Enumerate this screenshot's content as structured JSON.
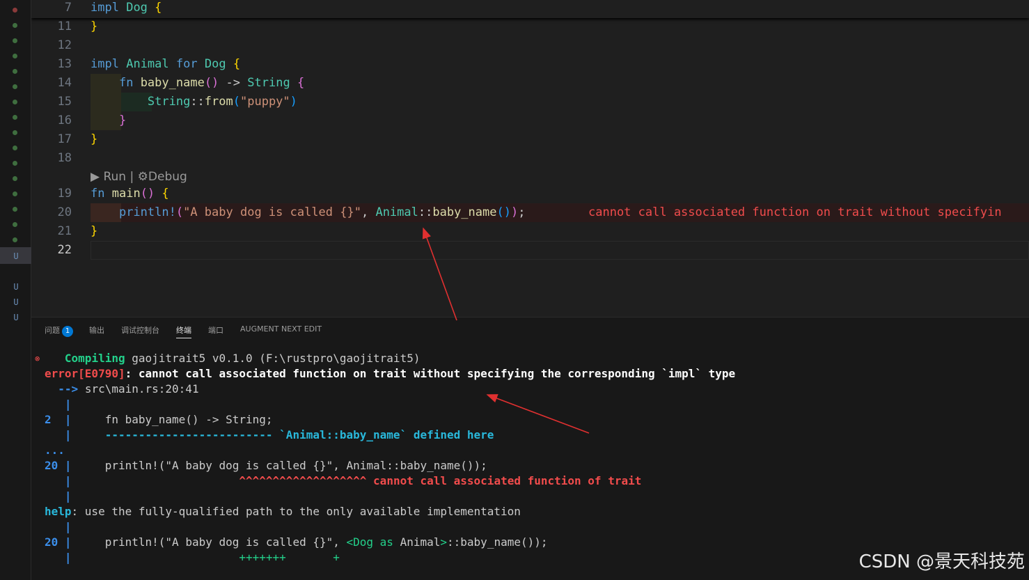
{
  "editor": {
    "sticky": {
      "line_no": "7",
      "code": "impl Dog {"
    },
    "lines": [
      {
        "n": "11"
      },
      {
        "n": "12"
      },
      {
        "n": "13"
      },
      {
        "n": "14"
      },
      {
        "n": "15"
      },
      {
        "n": "16"
      },
      {
        "n": "17"
      },
      {
        "n": "18"
      },
      {
        "n": "19"
      },
      {
        "n": "20"
      },
      {
        "n": "21"
      },
      {
        "n": "22"
      }
    ],
    "code": {
      "l11": "}",
      "l13": [
        "impl",
        "Animal",
        "for",
        "Dog",
        "{"
      ],
      "l14": [
        "fn",
        "baby_name",
        "()",
        "->",
        "String",
        "{"
      ],
      "l15": [
        "String",
        "::",
        "from",
        "(",
        "\"puppy\"",
        ")"
      ],
      "l16": "}",
      "l17": "}",
      "l19": [
        "fn",
        "main",
        "()",
        "{"
      ],
      "l20": [
        "println!",
        "(",
        "\"A baby dog is called {}\"",
        ", ",
        "Animal",
        "::",
        "baby_name",
        "()",
        ")",
        ";"
      ],
      "l21": "}"
    },
    "codelens": {
      "run": "Run",
      "separator": "|",
      "debug": "Debug"
    },
    "inline_error": "cannot call associated function on trait without specifyin"
  },
  "panel": {
    "tabs": [
      {
        "label": "问题",
        "badge": "1"
      },
      {
        "label": "输出"
      },
      {
        "label": "调试控制台"
      },
      {
        "label": "终端",
        "active": true
      },
      {
        "label": "端口"
      },
      {
        "label": "AUGMENT NEXT EDIT"
      }
    ],
    "terminal": {
      "compiling_label": "Compiling",
      "compiling_rest": "gaojitrait5 v0.1.0 (F:\\rustpro\\gaojitrait5)",
      "error_code": "error[E0790]",
      "error_msg": ": cannot call associated function on trait without specifying the corresponding `impl` type",
      "arrow": "-->",
      "location": "src\\main.rs:20:41",
      "pipe": "|",
      "ln2": "2",
      "ln2_code": "fn baby_name() -> String;",
      "dashes": "------------------------- `Animal::baby_name` defined here",
      "ellipsis": "...",
      "ln20": "20",
      "ln20_code": "println!(\"A baby dog is called {}\", Animal::baby_name());",
      "carets": "^^^^^^^^^^^^^^^^^^^",
      "caret_msg": "cannot call associated function of trait",
      "help_label": "help",
      "help_msg": ": use the fully-qualified path to the only available implementation",
      "fix_prefix": "println!(\"A baby dog is called {}\", ",
      "fix_open": "<",
      "fix_dog_as": "Dog as ",
      "fix_close": ">",
      "fix_suffix": "::baby_name());",
      "pluses": "+++++++",
      "plus_end": "+"
    }
  },
  "strip": {
    "u_letters": [
      "U",
      "U",
      "U",
      "U"
    ]
  },
  "watermark": "CSDN @景天科技苑",
  "colors": {
    "error": "#f14c4c",
    "success": "#23d18b",
    "keyword": "#569cd6",
    "type": "#4ec9b0",
    "arrow": "#e03030"
  }
}
